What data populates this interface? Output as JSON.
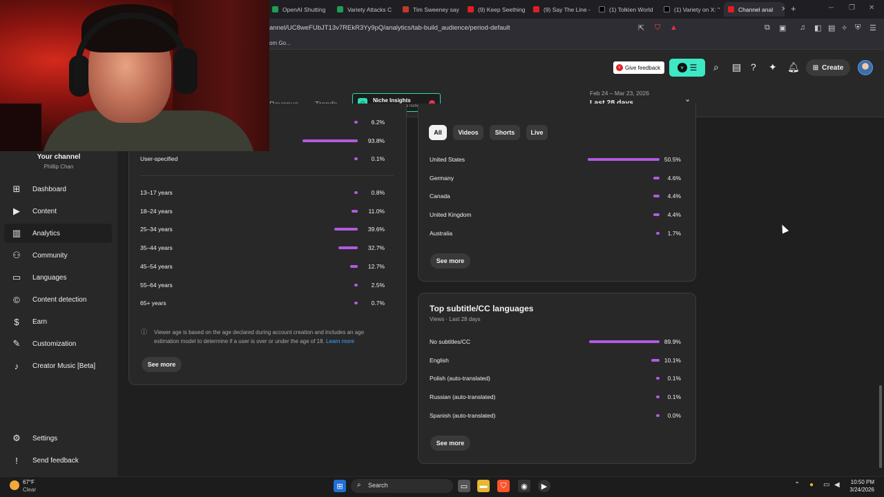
{
  "browser": {
    "tabs": [
      {
        "label": "OpenAI Shutting",
        "color": "#1f9d55"
      },
      {
        "label": "Variety Attacks C",
        "color": "#1f9d55"
      },
      {
        "label": "Tim Sweeney say",
        "color": "#c0392b"
      },
      {
        "label": "(9) Keep Seething",
        "color": "#e02020"
      },
      {
        "label": "(9) Say The Line -",
        "color": "#e02020"
      },
      {
        "label": "(1) Tolkien World",
        "color": "#222222"
      },
      {
        "label": "(1) Variety on X: \"",
        "color": "#222222"
      },
      {
        "label": "Channel anal",
        "color": "#e02020"
      }
    ],
    "url": "annel/UC8weFUbJT13v7REkR3Yy9pQ/analytics/tab-build_audience/period-default",
    "bookmark": "om Go..."
  },
  "header": {
    "feedback_label": "Give feedback",
    "create_label": "Create"
  },
  "subnav": {
    "revenue": "Revenue",
    "trends": "Trends",
    "niche_title": "Niche Insights",
    "niche_sub": "Analyze your entire niche",
    "period_range": "Feb 24 – Mar 23, 2026",
    "period_label": "Last 28 days"
  },
  "sidebar": {
    "channel_title": "Your channel",
    "channel_name": "Phillip Chan",
    "items": [
      {
        "label": "Dashboard",
        "icon": "dashboard-icon"
      },
      {
        "label": "Content",
        "icon": "content-icon"
      },
      {
        "label": "Analytics",
        "icon": "analytics-icon"
      },
      {
        "label": "Community",
        "icon": "community-icon"
      },
      {
        "label": "Languages",
        "icon": "languages-icon"
      },
      {
        "label": "Content detection",
        "icon": "copyright-icon"
      },
      {
        "label": "Earn",
        "icon": "earn-icon"
      },
      {
        "label": "Customization",
        "icon": "customization-icon"
      },
      {
        "label": "Creator Music [Beta]",
        "icon": "music-icon"
      }
    ],
    "settings": "Settings",
    "send_feedback": "Send feedback"
  },
  "gender": {
    "rows": [
      {
        "label": "",
        "pct": "6.2%",
        "value": 6.2
      },
      {
        "label": "",
        "pct": "93.8%",
        "value": 93.8
      },
      {
        "label": "User-specified",
        "pct": "0.1%",
        "value": 0.1
      }
    ]
  },
  "age": {
    "rows": [
      {
        "label": "13–17 years",
        "pct": "0.8%",
        "value": 0.8
      },
      {
        "label": "18–24 years",
        "pct": "11.0%",
        "value": 11.0
      },
      {
        "label": "25–34 years",
        "pct": "39.6%",
        "value": 39.6
      },
      {
        "label": "35–44 years",
        "pct": "32.7%",
        "value": 32.7
      },
      {
        "label": "45–54 years",
        "pct": "12.7%",
        "value": 12.7
      },
      {
        "label": "55–64 years",
        "pct": "2.5%",
        "value": 2.5
      },
      {
        "label": "65+ years",
        "pct": "0.7%",
        "value": 0.7
      }
    ],
    "note": "Viewer age is based on the age declared during account creation and includes an age estimation model to determine if a user is over or under the age of 18.",
    "learn_more": "Learn more",
    "see_more": "See more"
  },
  "geography": {
    "chips": [
      "All",
      "Videos",
      "Shorts",
      "Live"
    ],
    "rows": [
      {
        "label": "United States",
        "pct": "50.5%",
        "value": 50.5
      },
      {
        "label": "Germany",
        "pct": "4.6%",
        "value": 4.6
      },
      {
        "label": "Canada",
        "pct": "4.4%",
        "value": 4.4
      },
      {
        "label": "United Kingdom",
        "pct": "4.4%",
        "value": 4.4
      },
      {
        "label": "Australia",
        "pct": "1.7%",
        "value": 1.7
      }
    ],
    "see_more": "See more"
  },
  "subtitles": {
    "title": "Top subtitle/CC languages",
    "subtitle": "Views · Last 28 days",
    "rows": [
      {
        "label": "No subtitles/CC",
        "pct": "89.9%",
        "value": 89.9
      },
      {
        "label": "English",
        "pct": "10.1%",
        "value": 10.1
      },
      {
        "label": "Polish (auto-translated)",
        "pct": "0.1%",
        "value": 0.1
      },
      {
        "label": "Russian (auto-translated)",
        "pct": "0.1%",
        "value": 0.1
      },
      {
        "label": "Spanish (auto-translated)",
        "pct": "0.0%",
        "value": 0.0
      }
    ],
    "see_more": "See more"
  },
  "taskbar": {
    "temp": "67°F",
    "weather": "Clear",
    "search": "Search",
    "time": "10:50 PM",
    "date": "3/24/2026"
  },
  "colors": {
    "bar": "#b35ae0",
    "accent_teal": "#3de8c4"
  }
}
